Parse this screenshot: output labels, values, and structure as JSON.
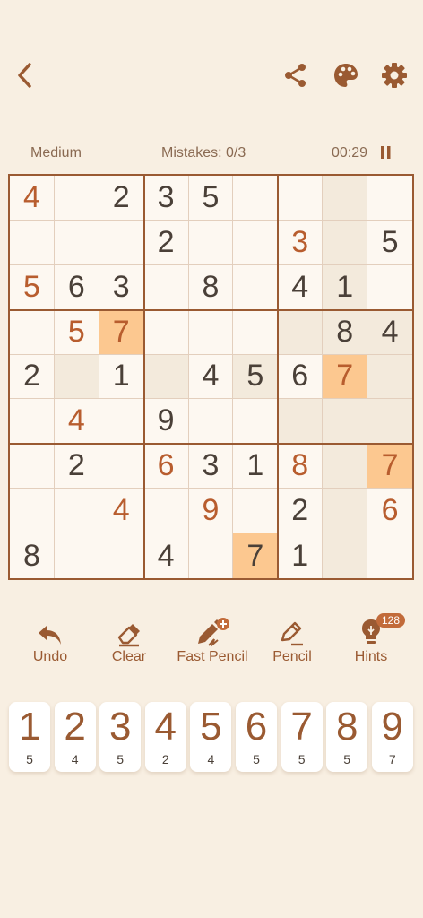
{
  "header": {
    "back_icon": "chevron-left-icon",
    "share_icon": "share-icon",
    "palette_icon": "palette-icon",
    "settings_icon": "gear-icon"
  },
  "status": {
    "difficulty": "Medium",
    "mistakes": "Mistakes: 0/3",
    "timer": "00:29",
    "pause_icon": "pause-icon"
  },
  "board": {
    "cells": [
      [
        "4",
        "",
        "2",
        "3",
        "5",
        "",
        "",
        "",
        ""
      ],
      [
        "",
        "",
        "",
        "2",
        "",
        "",
        "3",
        "",
        "5"
      ],
      [
        "5",
        "6",
        "3",
        "",
        "8",
        "",
        "4",
        "1",
        ""
      ],
      [
        "",
        "5",
        "7",
        "",
        "",
        "",
        "",
        "8",
        "4"
      ],
      [
        "2",
        "",
        "1",
        "",
        "4",
        "5",
        "6",
        "7",
        ""
      ],
      [
        "",
        "4",
        "",
        "9",
        "",
        "",
        "",
        "",
        ""
      ],
      [
        "",
        "2",
        "",
        "6",
        "3",
        "1",
        "8",
        "",
        "7"
      ],
      [
        "",
        "",
        "4",
        "",
        "9",
        "",
        "2",
        "",
        "6"
      ],
      [
        "8",
        "",
        "",
        "4",
        "",
        "7",
        "1",
        "",
        ""
      ]
    ],
    "user_entered": [
      [
        0,
        0
      ],
      [
        1,
        6
      ],
      [
        2,
        0
      ],
      [
        3,
        1
      ],
      [
        3,
        2
      ],
      [
        4,
        7
      ],
      [
        5,
        1
      ],
      [
        6,
        3
      ],
      [
        6,
        6
      ],
      [
        6,
        8
      ],
      [
        7,
        2
      ],
      [
        7,
        4
      ],
      [
        7,
        8
      ]
    ],
    "highlighted": [
      [
        0,
        7
      ],
      [
        1,
        7
      ],
      [
        2,
        7
      ],
      [
        3,
        6
      ],
      [
        3,
        7
      ],
      [
        3,
        8
      ],
      [
        4,
        1
      ],
      [
        4,
        3
      ],
      [
        4,
        5
      ],
      [
        4,
        8
      ],
      [
        5,
        6
      ],
      [
        5,
        7
      ],
      [
        5,
        8
      ],
      [
        6,
        7
      ],
      [
        7,
        7
      ],
      [
        8,
        7
      ]
    ],
    "selected": [
      [
        3,
        2
      ],
      [
        4,
        7
      ],
      [
        6,
        8
      ],
      [
        8,
        5
      ]
    ]
  },
  "tools": [
    {
      "label": "Undo",
      "icon": "undo-icon"
    },
    {
      "label": "Clear",
      "icon": "eraser-icon"
    },
    {
      "label": "Fast Pencil",
      "icon": "fast-pencil-icon"
    },
    {
      "label": "Pencil",
      "icon": "pencil-icon"
    },
    {
      "label": "Hints",
      "icon": "lightbulb-icon",
      "badge": "128"
    }
  ],
  "numpad": [
    {
      "digit": "1",
      "count": "5"
    },
    {
      "digit": "2",
      "count": "4"
    },
    {
      "digit": "3",
      "count": "5"
    },
    {
      "digit": "4",
      "count": "2"
    },
    {
      "digit": "5",
      "count": "4"
    },
    {
      "digit": "6",
      "count": "5"
    },
    {
      "digit": "7",
      "count": "5"
    },
    {
      "digit": "8",
      "count": "5"
    },
    {
      "digit": "9",
      "count": "7"
    }
  ],
  "colors": {
    "accent": "#9a5a32",
    "user_digit": "#b85d2e",
    "selected": "#fcc890",
    "highlight": "#f3eadc",
    "background": "#f8efe2"
  }
}
